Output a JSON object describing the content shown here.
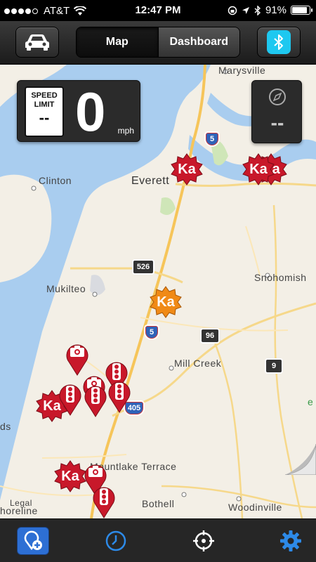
{
  "status_bar": {
    "signal_dots_filled": 4,
    "signal_dots_total": 5,
    "carrier": "AT&T",
    "time": "12:47 PM",
    "battery_percent_label": "91%",
    "battery_level": 0.91
  },
  "toolbar": {
    "car_icon": "car-icon",
    "segment_map": "Map",
    "segment_dashboard": "Dashboard",
    "selected_segment": "Map",
    "bluetooth_icon": "bluetooth-icon",
    "bluetooth_color": "#1ec8f0"
  },
  "speed_panel": {
    "sign_line1": "SPEED",
    "sign_line2": "LIMIT",
    "sign_value": "--",
    "speed": "0",
    "unit": "mph"
  },
  "compass_panel": {
    "icon": "compass-icon",
    "heading": "--"
  },
  "map": {
    "places": {
      "marysville": "Marysville",
      "everett": "Everett",
      "clinton": "Clinton",
      "mukilteo": "Mukilteo",
      "snohomish": "Snohomish",
      "mill_creek": "Mill Creek",
      "mountlake_terrace": "Mountlake Terrace",
      "bothell": "Bothell",
      "woodinville": "Woodinville",
      "legal": "Legal",
      "horeline": "horeline",
      "ds": "ds",
      "e": "e"
    },
    "shields": {
      "i5_a": "5",
      "i5_b": "5",
      "sr526": "526",
      "sr96": "96",
      "sr9": "9",
      "i405": "405"
    },
    "marker_labels": {
      "ka": "Ka"
    },
    "colors": {
      "water": "#a9cdef",
      "land": "#f3efe6",
      "park": "#cfe6b8",
      "road": "#f6d88a",
      "marker_red": "#c8182a",
      "marker_orange": "#f08a16"
    }
  },
  "tabbar": {
    "add_icon": "add-location-icon",
    "history_icon": "clock-icon",
    "locate_icon": "crosshair-icon",
    "settings_icon": "gear-icon",
    "active_color": "#2d8ae8"
  }
}
